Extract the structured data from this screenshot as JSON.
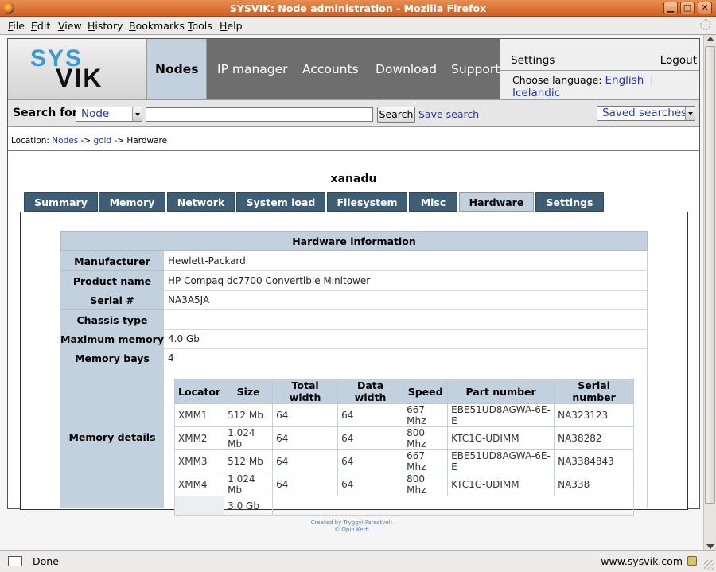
{
  "window": {
    "title": "SYSVIK: Node administration - Mozilla Firefox",
    "min_glyph": "▁",
    "max_glyph": "□",
    "close_glyph": "✕"
  },
  "menu": [
    "File",
    "Edit",
    "View",
    "History",
    "Bookmarks",
    "Tools",
    "Help"
  ],
  "logo": {
    "line1": "SYS",
    "line2": "VIK",
    "accent": "#3a9ad6"
  },
  "nav": {
    "items": [
      "Nodes",
      "IP manager",
      "Accounts",
      "Download",
      "Support"
    ],
    "active": "Nodes"
  },
  "header_right": {
    "settings": "Settings",
    "logout": "Logout",
    "choose_language": "Choose language:",
    "languages": [
      "English",
      "Icelandic"
    ],
    "separator": "|"
  },
  "search": {
    "label": "Search for:",
    "type_value": "Node",
    "input_value": "",
    "button": "Search",
    "save_link": "Save search",
    "saved_searches": "Saved searches"
  },
  "breadcrumb": {
    "prefix": "Location:",
    "items": [
      "Nodes",
      "gold",
      "Hardware"
    ],
    "arrow": "->"
  },
  "node_name": "xanadu",
  "tabs": {
    "items": [
      "Summary",
      "Memory",
      "Network",
      "System load",
      "Filesystem",
      "Misc",
      "Hardware",
      "Settings"
    ],
    "active": "Hardware"
  },
  "hardware": {
    "title": "Hardware information",
    "rows": [
      {
        "key": "Manufacturer",
        "value": "Hewlett-Packard"
      },
      {
        "key": "Product name",
        "value": "HP Compaq dc7700 Convertible Minitower"
      },
      {
        "key": "Serial #",
        "value": "NA3A5JA"
      },
      {
        "key": "Chassis type",
        "value": ""
      },
      {
        "key": "Maximum memory",
        "value": "4.0 Gb"
      },
      {
        "key": "Memory bays",
        "value": "4"
      }
    ],
    "memory_details_label": "Memory details",
    "memory": {
      "headers": [
        "Locator",
        "Size",
        "Total width",
        "Data width",
        "Speed",
        "Part number",
        "Serial number"
      ],
      "rows": [
        [
          "XMM1",
          "512 Mb",
          "64",
          "64",
          "667 Mhz",
          "EBE51UD8AGWA-6E-E",
          "NA323123"
        ],
        [
          "XMM2",
          "1.024 Mb",
          "64",
          "64",
          "800 Mhz",
          "KTC1G-UDIMM",
          "NA38282"
        ],
        [
          "XMM3",
          "512 Mb",
          "64",
          "64",
          "667 Mhz",
          "EBE51UD8AGWA-6E-E",
          "NA3384843"
        ],
        [
          "XMM4",
          "1.024 Mb",
          "64",
          "64",
          "800 Mhz",
          "KTC1G-UDIMM",
          "NA338"
        ]
      ],
      "total": "3.0 Gb"
    }
  },
  "footer": {
    "line1": "Created by Tryggvi Farestveit",
    "line2": "© Opin Kerfi"
  },
  "status": {
    "text": "Done",
    "host": "www.sysvik.com"
  },
  "colors": {
    "nav_bg": "#6e6e6e",
    "active_tab": "#c3d0de",
    "tab_bg": "#3e5e75",
    "link": "#2136b8",
    "titlebar": "#d96b2a"
  }
}
